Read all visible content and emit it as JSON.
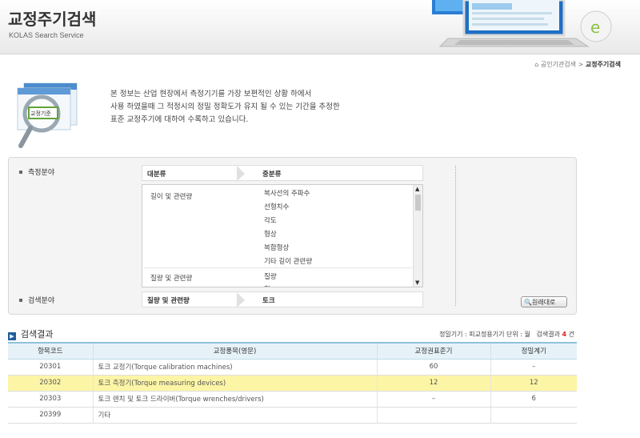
{
  "header": {
    "title": "교정주기검색",
    "subtitle": "KOLAS Search Service"
  },
  "breadcrumb": {
    "home": "공인기관검색",
    "sep": ">",
    "current": "교정주기검색"
  },
  "intro": {
    "badge": "교정기준",
    "lines": [
      "본 정보는 산업 현장에서 측정기기를 가장 보편적인 상황 하에서",
      "사용 하였을때 그 적정시의 정밀 정확도가 유지 될 수 있는 기간을 추정한",
      "표준 교정주기에 대하여 수록하고 있습니다."
    ]
  },
  "search": {
    "field_label": "측정분야",
    "col_major": "대분류",
    "col_minor": "중분류",
    "groups": [
      {
        "name": "길이 및 관련량",
        "items": [
          "복사선의 주파수",
          "선형치수",
          "각도",
          "형상",
          "복합형상",
          "기타 길이 관련량"
        ]
      },
      {
        "name": "질량 및 관련량",
        "items": [
          "질량",
          "힘"
        ]
      }
    ],
    "scroll_up": "▲",
    "scroll_down": "▼",
    "area_label": "검색분야",
    "selected_major": "질량 및 관련량",
    "selected_minor": "토크",
    "reset_label": "원래대로"
  },
  "results": {
    "title": "검색결과",
    "info_prefix": "정밀기기 : 피교정용기기 단위 : 월",
    "count_label": "검색결과",
    "count": "4",
    "count_unit": "건",
    "columns": [
      "항목코드",
      "교정품목(영문)",
      "교정권표준기",
      "정밀계기"
    ],
    "rows": [
      {
        "code": "20301",
        "name": "토크 교정기(Torque calibration machines)",
        "std": "60",
        "prec": "–"
      },
      {
        "code": "20302",
        "name": "토크 측정기(Torque measuring devices)",
        "std": "12",
        "prec": "12"
      },
      {
        "code": "20303",
        "name": "토크 렌치 및 토크 드라이버(Torque wrenches/drivers)",
        "std": "–",
        "prec": "6"
      },
      {
        "code": "20399",
        "name": "기타",
        "std": "",
        "prec": ""
      }
    ],
    "highlight_row": 1
  }
}
